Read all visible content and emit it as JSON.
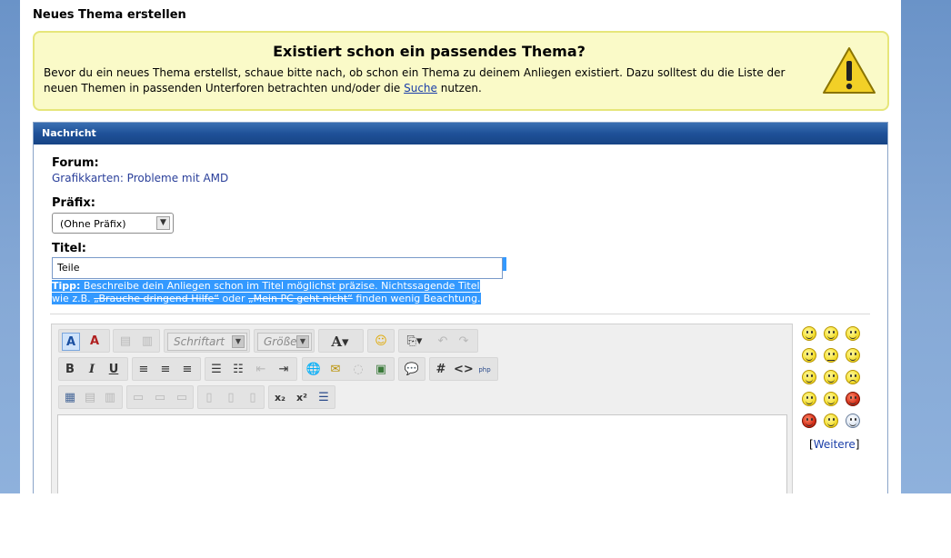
{
  "page_title": "Neues Thema erstellen",
  "notice": {
    "title": "Existiert schon ein passendes Thema?",
    "text_before": "Bevor du ein neues Thema erstellst, schaue bitte nach, ob schon ein Thema zu deinem Anliegen existiert. Dazu solltest du die Liste der neuen Themen in passenden Unterforen betrachten und/oder die ",
    "link": "Suche",
    "text_after": " nutzen."
  },
  "message_box": {
    "header": "Nachricht",
    "forum_label": "Forum:",
    "forum_value": "Grafikkarten: Probleme mit AMD",
    "prefix_label": "Präfix:",
    "prefix_value": "(Ohne Präfix)",
    "title_label": "Titel:",
    "title_value": "Teile",
    "tip_bold": "Tipp:",
    "tip_line1": " Beschreibe dein Anliegen schon im Titel möglichst präzise. Nichtssagende Titel",
    "tip_line2a": "wie z.B. ",
    "tip_struck1": "„Brauche dringend Hilfe“",
    "tip_mid": " oder ",
    "tip_struck2": "„Mein PC geht nicht“",
    "tip_end": " finden wenig Beachtung."
  },
  "editor": {
    "font_placeholder": "Schriftart",
    "size_placeholder": "Größe"
  },
  "smilies": {
    "more_prefix": "[",
    "more_link": "Weitere",
    "more_suffix": "]"
  }
}
